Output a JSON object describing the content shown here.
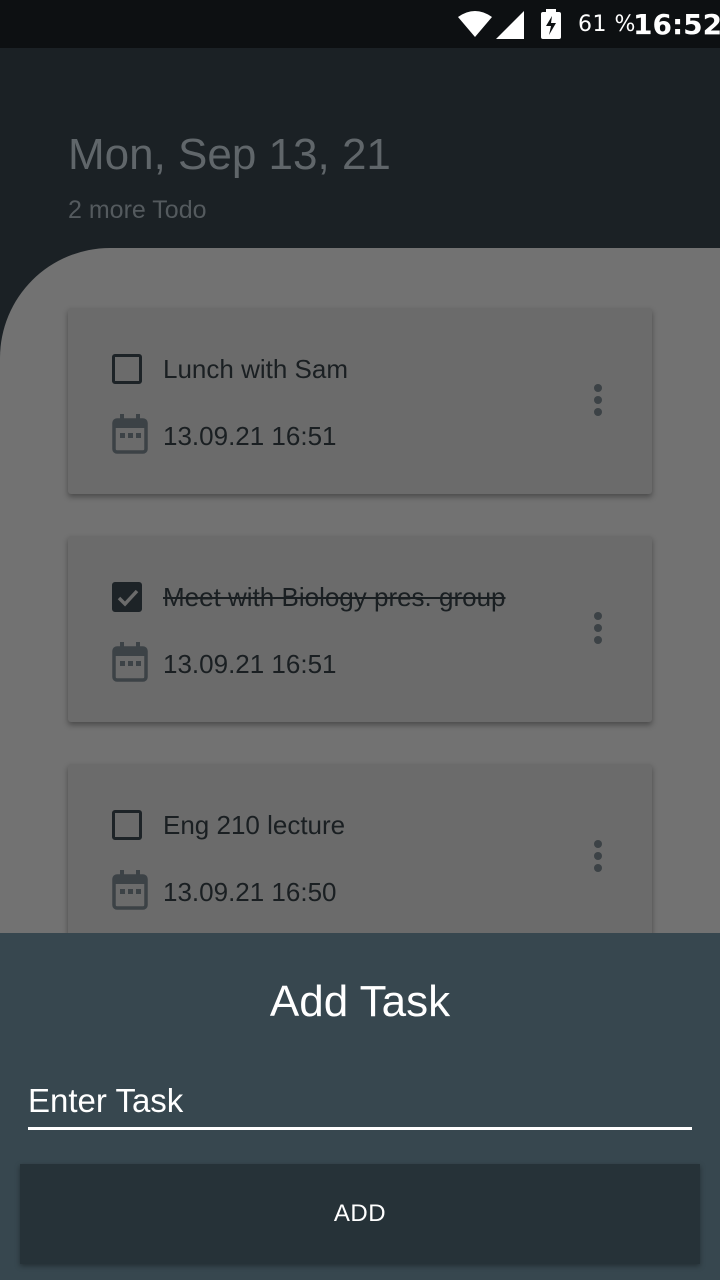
{
  "status_bar": {
    "battery_percent": "61 %",
    "time": "16:52",
    "icons": [
      "wifi-icon",
      "signal-icon",
      "battery-charging-icon"
    ]
  },
  "header": {
    "date": "Mon, Sep 13, 21",
    "subtitle": "2 more Todo"
  },
  "tasks": [
    {
      "title": "Lunch with Sam",
      "datetime": "13.09.21 16:51",
      "completed": false
    },
    {
      "title": "Meet with Biology pres. group",
      "datetime": "13.09.21 16:51",
      "completed": true
    },
    {
      "title": "Eng 210 lecture",
      "datetime": "13.09.21 16:50",
      "completed": false
    }
  ],
  "add_sheet": {
    "title": "Add Task",
    "input_placeholder": "Enter Task",
    "input_value": "",
    "button_label": "ADD"
  },
  "colors": {
    "sheet_background": "#37474f",
    "button_background": "#263238",
    "header_background": "#1b2125"
  }
}
